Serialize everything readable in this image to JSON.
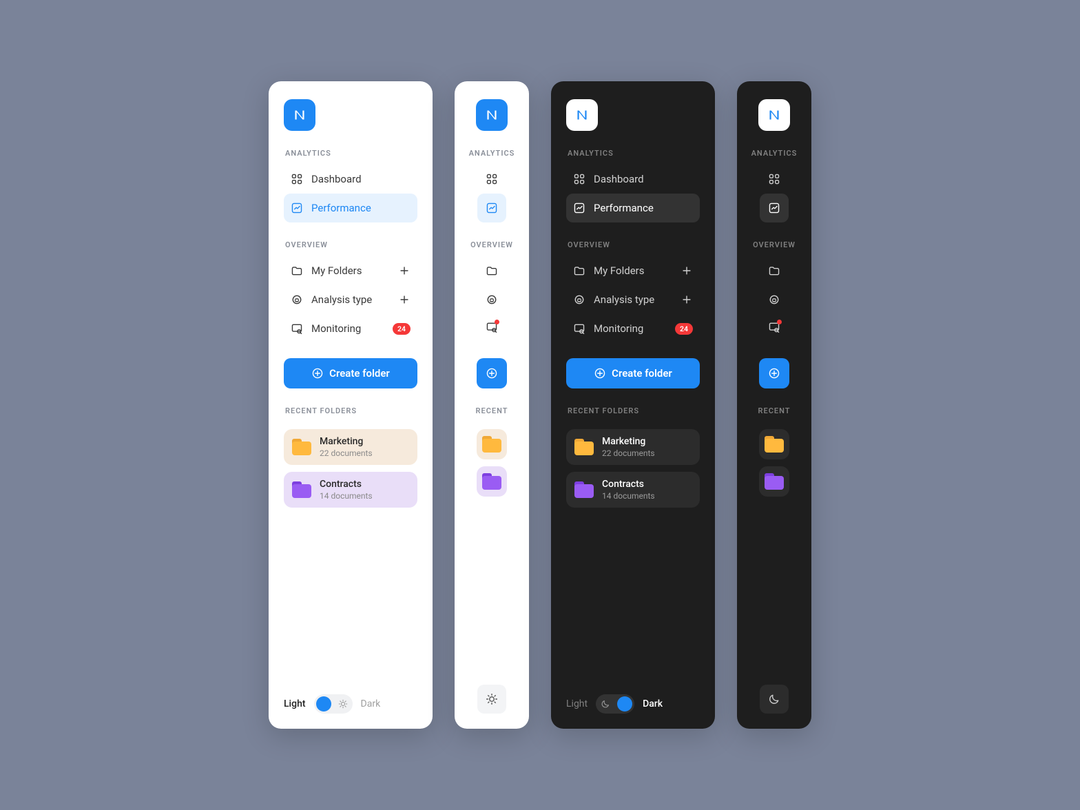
{
  "brand": {
    "letter": "N"
  },
  "sections": {
    "analytics": "ANALYTICS",
    "overview": "OVERVIEW",
    "recent_full": "RECENT FOLDERS",
    "recent_short": "RECENT"
  },
  "nav": {
    "dashboard": {
      "label": "Dashboard"
    },
    "performance": {
      "label": "Performance"
    },
    "folders": {
      "label": "My Folders"
    },
    "analysis": {
      "label": "Analysis type"
    },
    "monitoring": {
      "label": "Monitoring",
      "badge": "24"
    }
  },
  "create_button": "Create folder",
  "recent": [
    {
      "name": "Marketing",
      "sub": "22 documents",
      "color": "orange"
    },
    {
      "name": "Contracts",
      "sub": "14 documents",
      "color": "purple"
    }
  ],
  "theme": {
    "light": "Light",
    "dark": "Dark"
  },
  "colors": {
    "accent": "#1E88F4",
    "danger": "#F53838"
  }
}
